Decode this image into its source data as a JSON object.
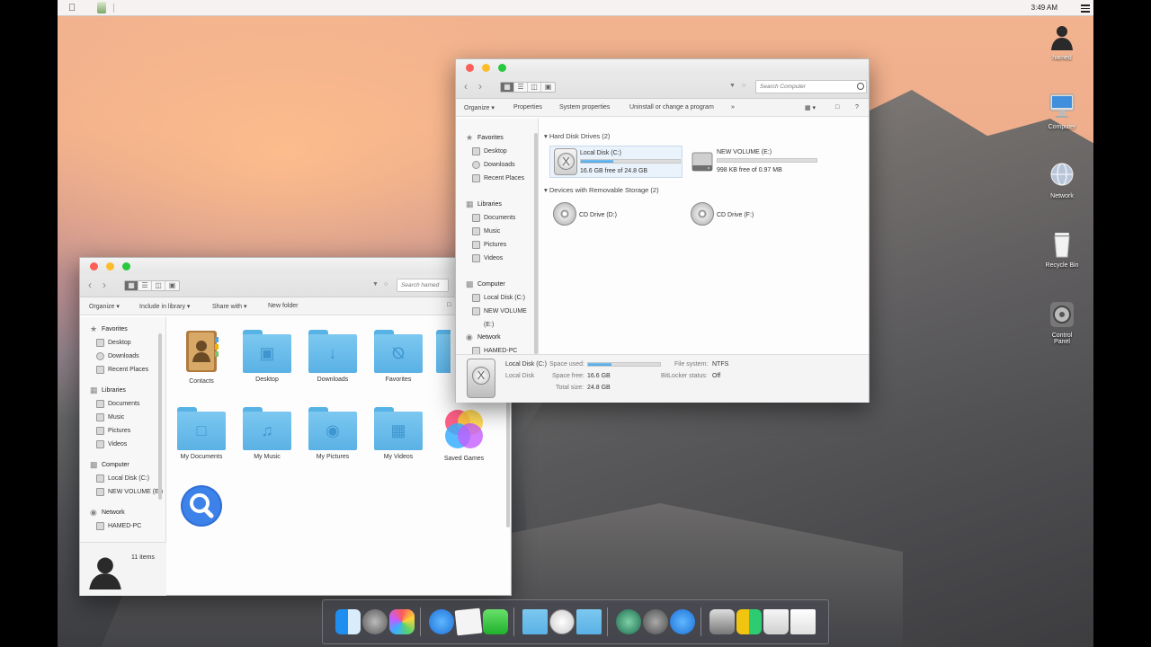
{
  "menubar": {
    "clock": "3:49 AM"
  },
  "desktop_icons": [
    {
      "label": "hamed",
      "icon": "user-icon"
    },
    {
      "label": "Computer",
      "icon": "imac-icon"
    },
    {
      "label": "Network",
      "icon": "globe-icon"
    },
    {
      "label": "Recycle Bin",
      "icon": "trash-icon"
    },
    {
      "label": "Control",
      "label2": "Panel",
      "icon": "gear-icon"
    }
  ],
  "computer_window": {
    "search_placeholder": "Search Computer",
    "commands": [
      "Organize ▾",
      "Properties",
      "System properties",
      "Uninstall or change a program",
      "»"
    ],
    "nav": {
      "favorites": {
        "label": "Favorites",
        "items": [
          "Desktop",
          "Downloads",
          "Recent Places"
        ]
      },
      "libraries": {
        "label": "Libraries",
        "items": [
          "Documents",
          "Music",
          "Pictures",
          "Videos"
        ]
      },
      "computer": {
        "label": "Computer",
        "items": [
          "Local Disk (C:)",
          "NEW VOLUME (E:)"
        ]
      },
      "network": {
        "label": "Network",
        "items": [
          "HAMED-PC"
        ]
      }
    },
    "sections": {
      "hard_disks": "Hard Disk Drives (2)",
      "removable": "Devices with Removable Storage (2)"
    },
    "drives": [
      {
        "name": "Local Disk (C:)",
        "free": "16.6 GB free of 24.8 GB",
        "used_fraction": 0.33
      },
      {
        "name": "NEW VOLUME (E:)",
        "free": "998 KB free of 0.97 MB",
        "used_fraction": 0.0
      }
    ],
    "removable": [
      "CD Drive (D:)",
      "CD Drive (F:)"
    ],
    "details": {
      "name": "Local Disk (C:)",
      "type": "Local Disk",
      "space_used_label": "Space used:",
      "space_used_fraction": 0.33,
      "space_free_label": "Space free:",
      "space_free": "16.6 GB",
      "total_label": "Total size:",
      "total": "24.8 GB",
      "fs_label": "File system:",
      "fs": "NTFS",
      "bitlocker_label": "BitLocker status:",
      "bitlocker": "Off"
    }
  },
  "user_window": {
    "search_placeholder": "Search hamed",
    "commands": [
      "Organize ▾",
      "Include in library ▾",
      "Share with ▾",
      "New folder"
    ],
    "nav": {
      "favorites": {
        "label": "Favorites",
        "items": [
          "Desktop",
          "Downloads",
          "Recent Places"
        ]
      },
      "libraries": {
        "label": "Libraries",
        "items": [
          "Documents",
          "Music",
          "Pictures",
          "Videos"
        ]
      },
      "computer": {
        "label": "Computer",
        "items": [
          "Local Disk (C:)",
          "NEW VOLUME (E:)"
        ]
      },
      "network": {
        "label": "Network",
        "items": [
          "HAMED-PC"
        ]
      }
    },
    "items": [
      "Contacts",
      "Desktop",
      "Downloads",
      "Favorites",
      "My Documents",
      "My Music",
      "My Pictures",
      "My Videos",
      "Saved Games",
      ""
    ],
    "item_count": "11 items"
  },
  "colors": {
    "close": "#fc5f57",
    "minimize": "#fdbc2e",
    "zoom": "#28c840",
    "folder": "#6bbdec",
    "progress": "#4aa7e5"
  }
}
